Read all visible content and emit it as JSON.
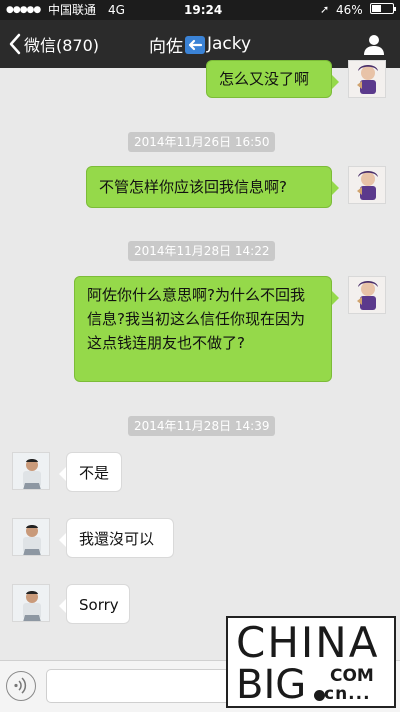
{
  "status_bar": {
    "signal": "●●●●●",
    "carrier": "中国联通",
    "network": "4G",
    "time": "19:24",
    "battery_percent": "46%",
    "battery_level": 0.46
  },
  "nav": {
    "back_label": "微信(870)",
    "title_part1": "向佐",
    "title_part2": "Jacky"
  },
  "messages": {
    "m1": "怎么又没了啊",
    "t1": "2014年11月26日 16:50",
    "m2": "不管怎样你应该回我信息啊?",
    "t2": "2014年11月28日 14:22",
    "m3": "阿佐你什么意思啊?为什么不回我信息?我当初这么信任你现在因为这点钱连朋友也不做了?",
    "t3": "2014年11月28日 14:39",
    "r1": "不是",
    "r2": "我還沒可以",
    "r3": "Sorry"
  },
  "watermark": {
    "line1": "CHINA",
    "line2": "BIG",
    "com": "COM",
    "cn": "cn..."
  },
  "colors": {
    "sent_bubble": "#95d94a",
    "received_bubble": "#ffffff",
    "nav_bg": "#2b2b2b",
    "chat_bg": "#e9e9e9"
  },
  "icons": {
    "back": "chevron-left-icon",
    "profile": "person-icon",
    "voice": "voice-icon",
    "location": "location-arrow-icon",
    "battery": "battery-icon",
    "title_arrow": "back-arrow-emoji-icon"
  }
}
